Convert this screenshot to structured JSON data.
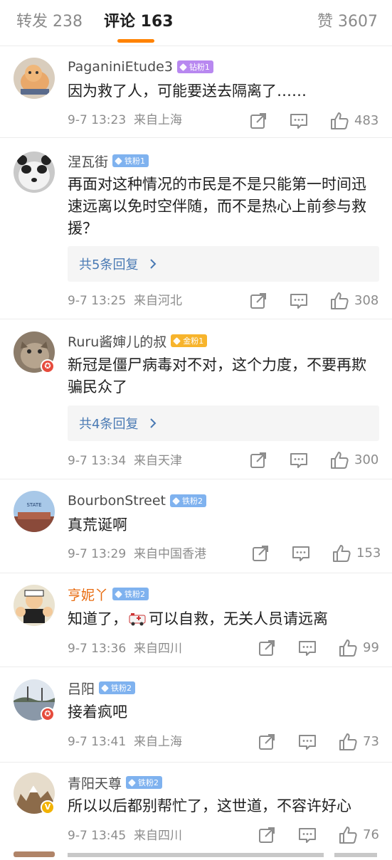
{
  "tabs": {
    "repost": "转发 238",
    "comments": "评论 163",
    "likes": "赞 3607"
  },
  "comments": [
    {
      "username": "PaganiniEtude3",
      "badge": "钻粉1",
      "badge_type": "diamond",
      "text": "因为救了人，可能要送去隔离了……",
      "time": "9-7 13:23",
      "location": "来自上海",
      "likes": "483"
    },
    {
      "username": "涅瓦街",
      "badge": "铁粉1",
      "badge_type": "iron",
      "text": "再面对这种情况的市民是不是只能第一时间迅速远离以免时空伴随，而不是热心上前参与救援？",
      "replies": "共5条回复",
      "time": "9-7 13:25",
      "location": "来自河北",
      "likes": "308"
    },
    {
      "username": "Ruru酱婶儿的叔",
      "badge": "金粉1",
      "badge_type": "gold",
      "text": "新冠是僵尸病毒对不对，这个力度，不要再欺骗民众了",
      "replies": "共4条回复",
      "time": "9-7 13:34",
      "location": "来自天津",
      "likes": "300"
    },
    {
      "username": "BourbonStreet",
      "badge": "铁粉2",
      "badge_type": "iron",
      "text": "真荒诞啊",
      "time": "9-7 13:29",
      "location": "来自中国香港",
      "likes": "153"
    },
    {
      "username": "亨妮丫",
      "badge": "铁粉2",
      "badge_type": "iron",
      "text_before": "知道了，",
      "text_after": "可以自救，无关人员请远离",
      "time": "9-7 13:36",
      "location": "来自四川",
      "likes": "99"
    },
    {
      "username": "吕阳",
      "badge": "铁粉2",
      "badge_type": "iron",
      "text": "接着疯吧",
      "time": "9-7 13:41",
      "location": "来自上海",
      "likes": "73"
    },
    {
      "username": "青阳天尊",
      "badge": "铁粉2",
      "badge_type": "iron",
      "text": "所以以后都别帮忙了，这世道，不容许好心",
      "time": "9-7 13:45",
      "location": "来自四川",
      "likes": "76"
    }
  ],
  "colors": {
    "accent": "#ff8200",
    "link": "#4a7ab4",
    "iron_badge": "#7fb2ef",
    "diamond_badge": "#b888f0",
    "gold_badge": "#f7b42c"
  },
  "icons": [
    "share-icon",
    "comment-icon",
    "like-icon"
  ]
}
